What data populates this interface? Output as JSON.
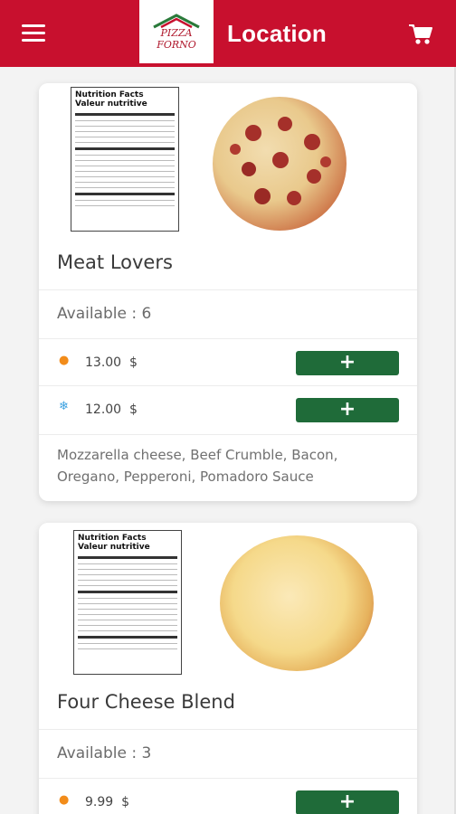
{
  "header": {
    "title": "Location",
    "logo_text": "PIZZA FORNO",
    "brand_color": "#c8102e",
    "menu_icon": "hamburger-menu-icon",
    "cart_icon": "shopping-cart-icon"
  },
  "nutrition_label": {
    "title_en": "Nutrition Facts",
    "title_fr": "Valeur nutritive"
  },
  "products": [
    {
      "name": "Meat Lovers",
      "availability": "Available : 6",
      "prices": [
        {
          "icon": "fire-icon",
          "value": "13.00",
          "currency": "$"
        },
        {
          "icon": "snowflake-icon",
          "value": "12.00",
          "currency": "$"
        }
      ],
      "add_label": "+",
      "description": "Mozzarella cheese, Beef Crumble, Bacon, Oregano, Pepperoni, Pomadoro Sauce"
    },
    {
      "name": "Four Cheese Blend",
      "availability": "Available : 3",
      "prices": [
        {
          "icon": "fire-icon",
          "value": "9.99",
          "currency": "$"
        }
      ],
      "add_label": "+"
    }
  ],
  "colors": {
    "add_button": "#1f6b39",
    "hot_icon": "#f28c1a",
    "frozen_icon": "#3aa0e0"
  }
}
